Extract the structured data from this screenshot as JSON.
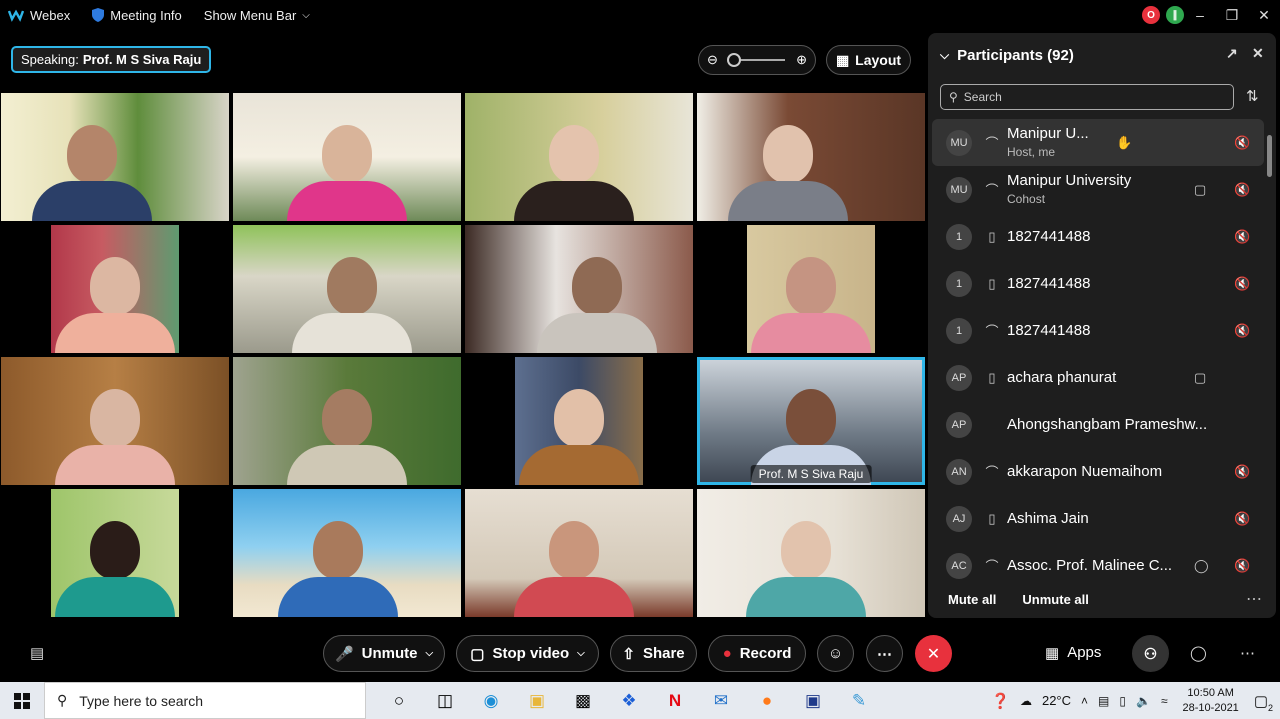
{
  "titlebar": {
    "app_name": "Webex",
    "meeting_info": "Meeting Info",
    "show_menu_bar": "Show Menu Bar",
    "rec_badge": "O"
  },
  "speaking": {
    "prefix": "Speaking:",
    "name": "Prof. M S Siva Raju"
  },
  "layout_label": "Layout",
  "active_tile_name": "Prof. M S Siva Raju",
  "participants": {
    "title": "Participants (92)",
    "search_placeholder": "Search",
    "list": [
      {
        "initials": "MU",
        "name": "Manipur U...",
        "sub": "Host, me",
        "device": "headset",
        "video": false,
        "mic_muted": true
      },
      {
        "initials": "MU",
        "name": "Manipur University",
        "sub": "Cohost",
        "device": "headset",
        "video": true,
        "mic_muted": true
      },
      {
        "initials": "1",
        "name": "1827441488",
        "sub": "",
        "device": "phone",
        "video": false,
        "mic_muted": true
      },
      {
        "initials": "1",
        "name": "1827441488",
        "sub": "",
        "device": "phone",
        "video": false,
        "mic_muted": true
      },
      {
        "initials": "1",
        "name": "1827441488",
        "sub": "",
        "device": "headset",
        "video": false,
        "mic_muted": true
      },
      {
        "initials": "AP",
        "name": "achara phanurat",
        "sub": "",
        "device": "phone",
        "video": true,
        "mic_muted": false
      },
      {
        "initials": "AP",
        "name": "Ahongshangbam Prameshw...",
        "sub": "",
        "device": "none",
        "video": false,
        "mic_muted": false
      },
      {
        "initials": "AN",
        "name": "akkarapon Nuemaihom",
        "sub": "",
        "device": "headset",
        "video": false,
        "mic_muted": true
      },
      {
        "initials": "AJ",
        "name": "Ashima Jain",
        "sub": "",
        "device": "phone",
        "video": false,
        "mic_muted": true
      },
      {
        "initials": "AC",
        "name": "Assoc. Prof. Malinee C...",
        "sub": "",
        "device": "headset",
        "video": false,
        "mic_muted": true
      }
    ],
    "mute_all": "Mute all",
    "unmute_all": "Unmute all"
  },
  "controls": {
    "unmute": "Unmute",
    "stop_video": "Stop video",
    "share": "Share",
    "record": "Record",
    "apps": "Apps"
  },
  "taskbar": {
    "search_placeholder": "Type here to search",
    "temperature": "22°C",
    "time": "10:50 AM",
    "date": "28-10-2021",
    "notifications": "2"
  }
}
